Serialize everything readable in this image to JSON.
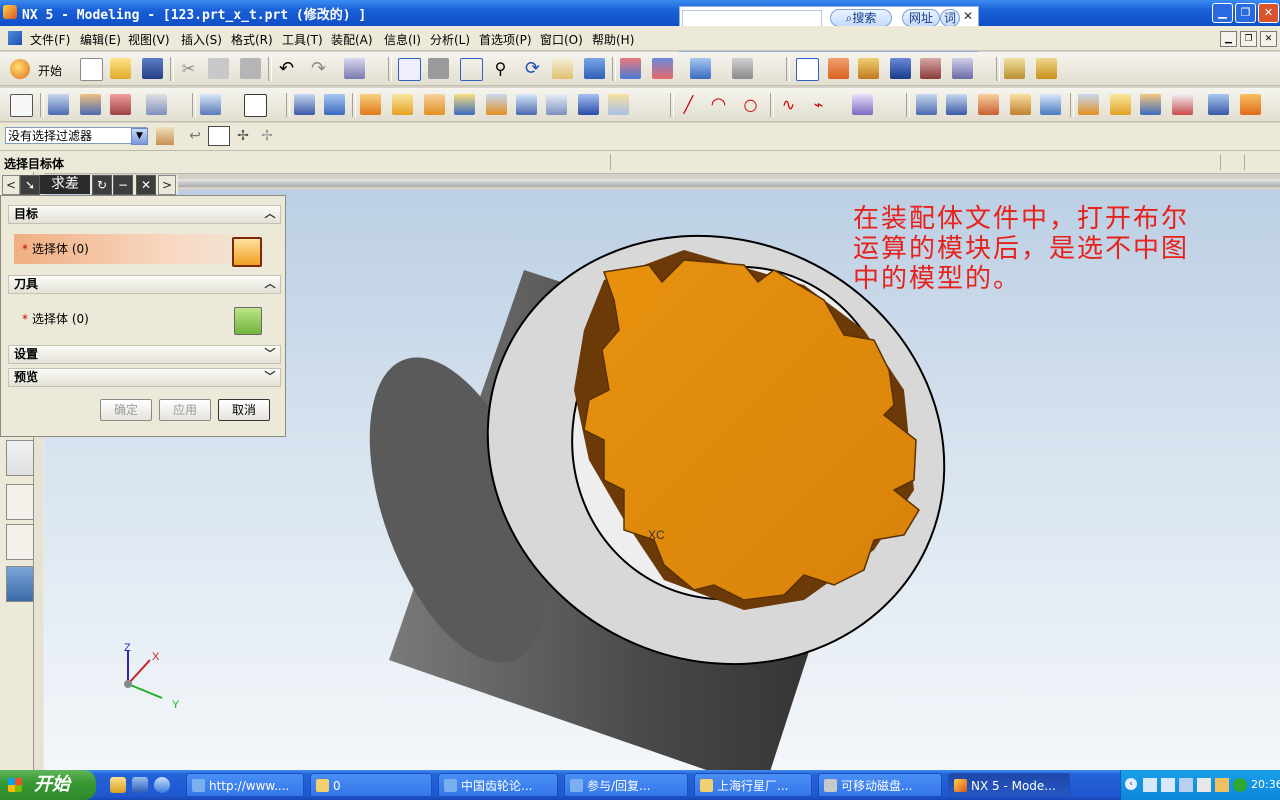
{
  "window": {
    "title": "NX 5 - Modeling - [123.prt_x_t.prt (修改的) ]"
  },
  "search_popup": {
    "search_label": "搜索",
    "address_label": "网址",
    "word_label": "词"
  },
  "menubar": {
    "items": [
      "文件(F)",
      "编辑(E)",
      "视图(V)",
      "插入(S)",
      "格式(R)",
      "工具(T)",
      "装配(A)",
      "信息(I)",
      "分析(L)",
      "首选项(P)",
      "窗口(O)",
      "帮助(H)"
    ]
  },
  "toolbar": {
    "start_label": "开始"
  },
  "filter": {
    "value": "没有选择过滤器"
  },
  "status": {
    "prompt": "选择目标体"
  },
  "dialog": {
    "title": "求差",
    "sections": {
      "target": "目标",
      "tool": "刀具",
      "settings": "设置",
      "preview": "预览"
    },
    "target_select": "选择体 (0)",
    "tool_select": "选择体 (0)",
    "ok_label": "确定",
    "apply_label": "应用",
    "cancel_label": "取消"
  },
  "annotation": {
    "text": "在装配体文件中，打开布尔运算的模块后，是选不中图中的模型的。"
  },
  "viewport": {
    "xc_label": "XC",
    "axis_z": "Z",
    "axis_x": "X",
    "axis_y": "Y"
  },
  "taskbar": {
    "start_label": "开始",
    "tasks": [
      "http://www....",
      "0",
      "中国齿轮论...",
      "参与/回复...",
      "上海行星厂...",
      "可移动磁盘...",
      "NX 5 - Mode..."
    ],
    "clock": "20:36"
  },
  "colors": {
    "annotation": "#e8211b",
    "gear_fill": "#e08a12",
    "body_fill": "#d5d5d5",
    "selection_row": "#f0b48a"
  }
}
